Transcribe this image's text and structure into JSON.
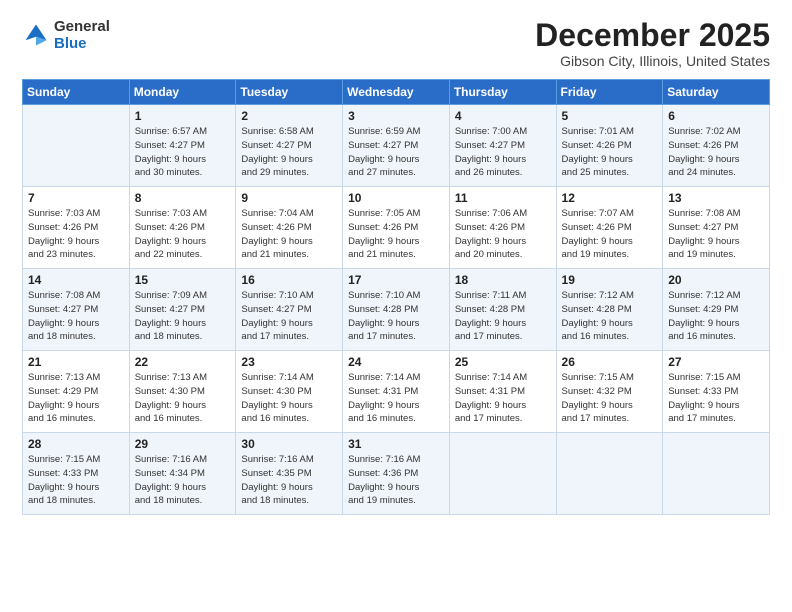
{
  "logo": {
    "general": "General",
    "blue": "Blue"
  },
  "title": "December 2025",
  "location": "Gibson City, Illinois, United States",
  "days_of_week": [
    "Sunday",
    "Monday",
    "Tuesday",
    "Wednesday",
    "Thursday",
    "Friday",
    "Saturday"
  ],
  "weeks": [
    [
      {
        "day": "",
        "info": ""
      },
      {
        "day": "1",
        "info": "Sunrise: 6:57 AM\nSunset: 4:27 PM\nDaylight: 9 hours\nand 30 minutes."
      },
      {
        "day": "2",
        "info": "Sunrise: 6:58 AM\nSunset: 4:27 PM\nDaylight: 9 hours\nand 29 minutes."
      },
      {
        "day": "3",
        "info": "Sunrise: 6:59 AM\nSunset: 4:27 PM\nDaylight: 9 hours\nand 27 minutes."
      },
      {
        "day": "4",
        "info": "Sunrise: 7:00 AM\nSunset: 4:27 PM\nDaylight: 9 hours\nand 26 minutes."
      },
      {
        "day": "5",
        "info": "Sunrise: 7:01 AM\nSunset: 4:26 PM\nDaylight: 9 hours\nand 25 minutes."
      },
      {
        "day": "6",
        "info": "Sunrise: 7:02 AM\nSunset: 4:26 PM\nDaylight: 9 hours\nand 24 minutes."
      }
    ],
    [
      {
        "day": "7",
        "info": "Sunrise: 7:03 AM\nSunset: 4:26 PM\nDaylight: 9 hours\nand 23 minutes."
      },
      {
        "day": "8",
        "info": "Sunrise: 7:03 AM\nSunset: 4:26 PM\nDaylight: 9 hours\nand 22 minutes."
      },
      {
        "day": "9",
        "info": "Sunrise: 7:04 AM\nSunset: 4:26 PM\nDaylight: 9 hours\nand 21 minutes."
      },
      {
        "day": "10",
        "info": "Sunrise: 7:05 AM\nSunset: 4:26 PM\nDaylight: 9 hours\nand 21 minutes."
      },
      {
        "day": "11",
        "info": "Sunrise: 7:06 AM\nSunset: 4:26 PM\nDaylight: 9 hours\nand 20 minutes."
      },
      {
        "day": "12",
        "info": "Sunrise: 7:07 AM\nSunset: 4:26 PM\nDaylight: 9 hours\nand 19 minutes."
      },
      {
        "day": "13",
        "info": "Sunrise: 7:08 AM\nSunset: 4:27 PM\nDaylight: 9 hours\nand 19 minutes."
      }
    ],
    [
      {
        "day": "14",
        "info": "Sunrise: 7:08 AM\nSunset: 4:27 PM\nDaylight: 9 hours\nand 18 minutes."
      },
      {
        "day": "15",
        "info": "Sunrise: 7:09 AM\nSunset: 4:27 PM\nDaylight: 9 hours\nand 18 minutes."
      },
      {
        "day": "16",
        "info": "Sunrise: 7:10 AM\nSunset: 4:27 PM\nDaylight: 9 hours\nand 17 minutes."
      },
      {
        "day": "17",
        "info": "Sunrise: 7:10 AM\nSunset: 4:28 PM\nDaylight: 9 hours\nand 17 minutes."
      },
      {
        "day": "18",
        "info": "Sunrise: 7:11 AM\nSunset: 4:28 PM\nDaylight: 9 hours\nand 17 minutes."
      },
      {
        "day": "19",
        "info": "Sunrise: 7:12 AM\nSunset: 4:28 PM\nDaylight: 9 hours\nand 16 minutes."
      },
      {
        "day": "20",
        "info": "Sunrise: 7:12 AM\nSunset: 4:29 PM\nDaylight: 9 hours\nand 16 minutes."
      }
    ],
    [
      {
        "day": "21",
        "info": "Sunrise: 7:13 AM\nSunset: 4:29 PM\nDaylight: 9 hours\nand 16 minutes."
      },
      {
        "day": "22",
        "info": "Sunrise: 7:13 AM\nSunset: 4:30 PM\nDaylight: 9 hours\nand 16 minutes."
      },
      {
        "day": "23",
        "info": "Sunrise: 7:14 AM\nSunset: 4:30 PM\nDaylight: 9 hours\nand 16 minutes."
      },
      {
        "day": "24",
        "info": "Sunrise: 7:14 AM\nSunset: 4:31 PM\nDaylight: 9 hours\nand 16 minutes."
      },
      {
        "day": "25",
        "info": "Sunrise: 7:14 AM\nSunset: 4:31 PM\nDaylight: 9 hours\nand 17 minutes."
      },
      {
        "day": "26",
        "info": "Sunrise: 7:15 AM\nSunset: 4:32 PM\nDaylight: 9 hours\nand 17 minutes."
      },
      {
        "day": "27",
        "info": "Sunrise: 7:15 AM\nSunset: 4:33 PM\nDaylight: 9 hours\nand 17 minutes."
      }
    ],
    [
      {
        "day": "28",
        "info": "Sunrise: 7:15 AM\nSunset: 4:33 PM\nDaylight: 9 hours\nand 18 minutes."
      },
      {
        "day": "29",
        "info": "Sunrise: 7:16 AM\nSunset: 4:34 PM\nDaylight: 9 hours\nand 18 minutes."
      },
      {
        "day": "30",
        "info": "Sunrise: 7:16 AM\nSunset: 4:35 PM\nDaylight: 9 hours\nand 18 minutes."
      },
      {
        "day": "31",
        "info": "Sunrise: 7:16 AM\nSunset: 4:36 PM\nDaylight: 9 hours\nand 19 minutes."
      },
      {
        "day": "",
        "info": ""
      },
      {
        "day": "",
        "info": ""
      },
      {
        "day": "",
        "info": ""
      }
    ]
  ]
}
